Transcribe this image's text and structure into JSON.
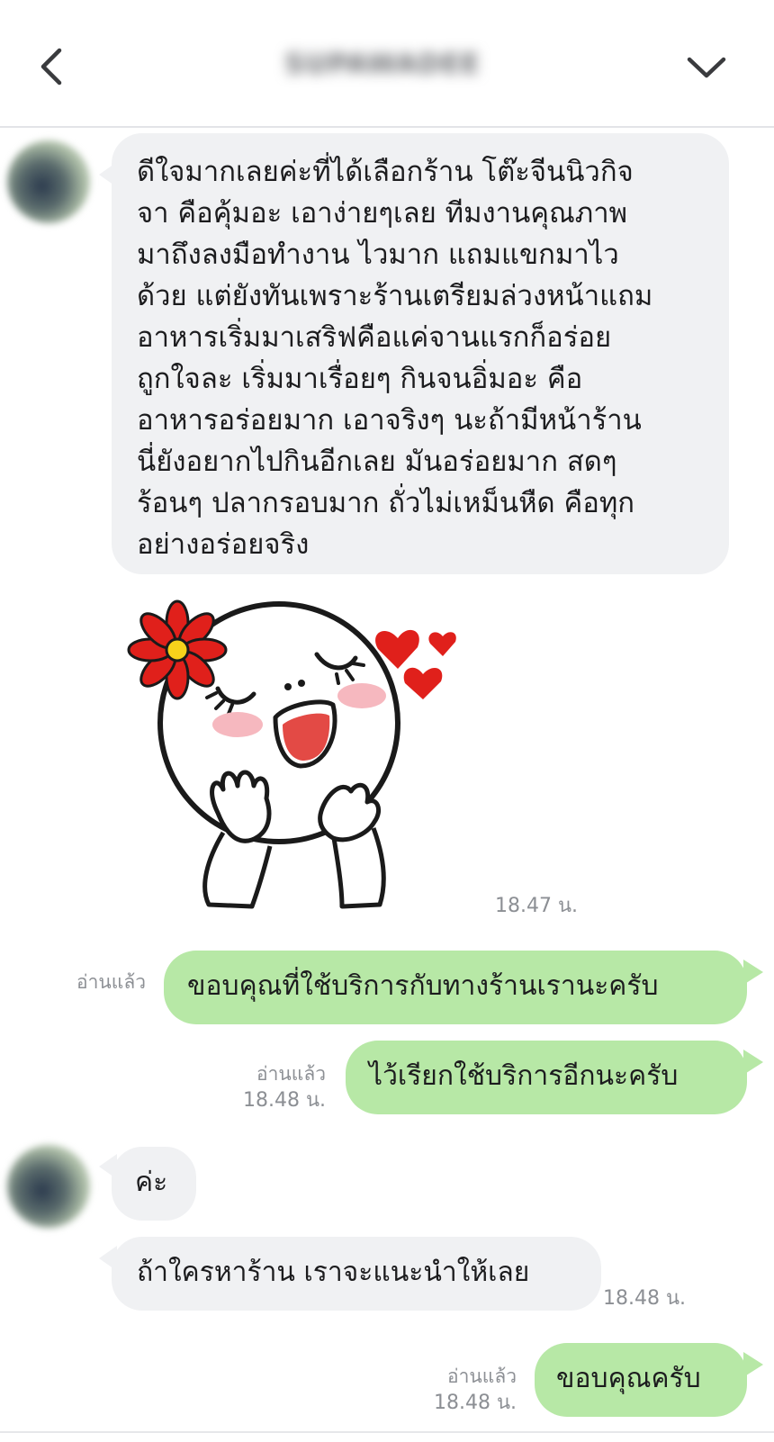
{
  "header": {
    "title": "SUPAWADEE",
    "back_icon": "chevron-left-icon",
    "menu_icon": "chevron-down-icon"
  },
  "colors": {
    "incoming_bubble": "#f0f1f3",
    "outgoing_bubble": "#b7e8a6",
    "meta_text": "#8c8f94"
  },
  "messages": [
    {
      "from": "contact",
      "text": "ดีใจมากเลยค่ะที่ได้เลือกร้าน โต๊ะจีนนิวกิจ\nจา คือคุ้มอะ เอาง่ายๆเลย ทีมงานคุณภาพ\nมาถึงลงมือทำงาน ไวมาก แถมแขกมาไว\nด้วย แต่ยังทันเพราะร้านเตรียมล่วงหน้าแถม\nอาหารเริ่มมาเสริฟคือแค่จานแรกก็อร่อย\nถูกใจละ เริ่มมาเรื่อยๆ กินจนอิ่มอะ คือ\nอาหารอร่อยมาก เอาจริงๆ นะถ้ามีหน้าร้าน\nนี่ยังอยากไปกินอีกเลย มันอร่อยมาก สดๆ\nร้อนๆ ปลากรอบมาก ถั่วไม่เหม็นหืด คือทุก\nอย่างอร่อยจริง"
    },
    {
      "from": "contact",
      "sticker": "happy-face-sticker",
      "time": "18.47 น."
    },
    {
      "from": "me",
      "text": "ขอบคุณที่ใช้บริการกับทางร้านเรานะครับ",
      "read": "อ่านแล้ว"
    },
    {
      "from": "me",
      "text": "ไว้เรียกใช้บริการอีกนะครับ",
      "read": "อ่านแล้ว",
      "time": "18.48 น."
    },
    {
      "from": "contact",
      "text": "ค่ะ"
    },
    {
      "from": "contact",
      "text": "ถ้าใครหาร้าน เราจะแนะนำให้เลย",
      "time": "18.48 น."
    },
    {
      "from": "me",
      "text": "ขอบคุณครับ",
      "read": "อ่านแล้ว",
      "time": "18.48 น."
    }
  ]
}
